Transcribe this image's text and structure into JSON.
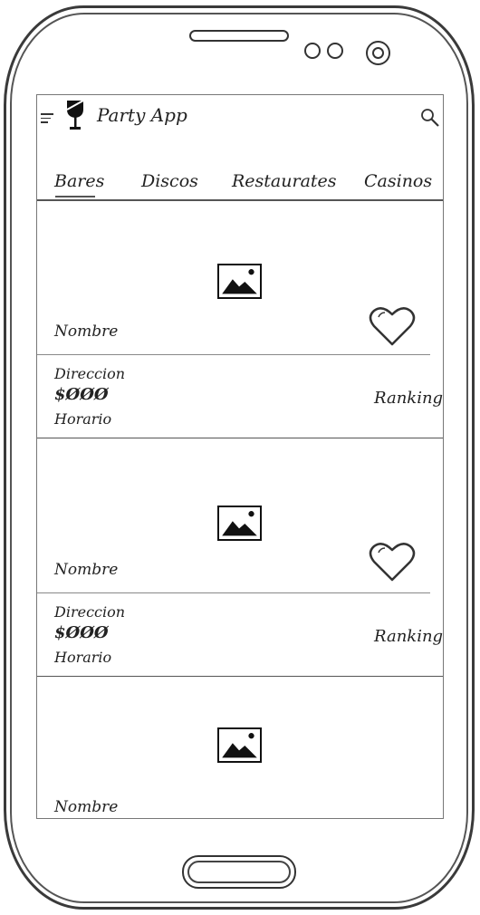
{
  "app": {
    "title": "Party App"
  },
  "tabs": [
    {
      "label": "Bares",
      "active": true
    },
    {
      "label": "Discos",
      "active": false
    },
    {
      "label": "Restaurates",
      "active": false
    },
    {
      "label": "Casinos",
      "active": false
    }
  ],
  "cards": [
    {
      "name": "Nombre",
      "address": "Direccion",
      "price": "$ØØØ",
      "hours": "Horario",
      "ranking": "Ranking"
    },
    {
      "name": "Nombre",
      "address": "Direccion",
      "price": "$ØØØ",
      "hours": "Horario",
      "ranking": "Ranking"
    },
    {
      "name": "Nombre"
    }
  ],
  "icons": {
    "menu": "menu-icon",
    "logo": "wine-glass-icon",
    "search": "search-icon",
    "image": "image-placeholder-icon",
    "favorite": "heart-icon"
  },
  "colors": {
    "stroke": "#333333",
    "background": "#ffffff"
  }
}
